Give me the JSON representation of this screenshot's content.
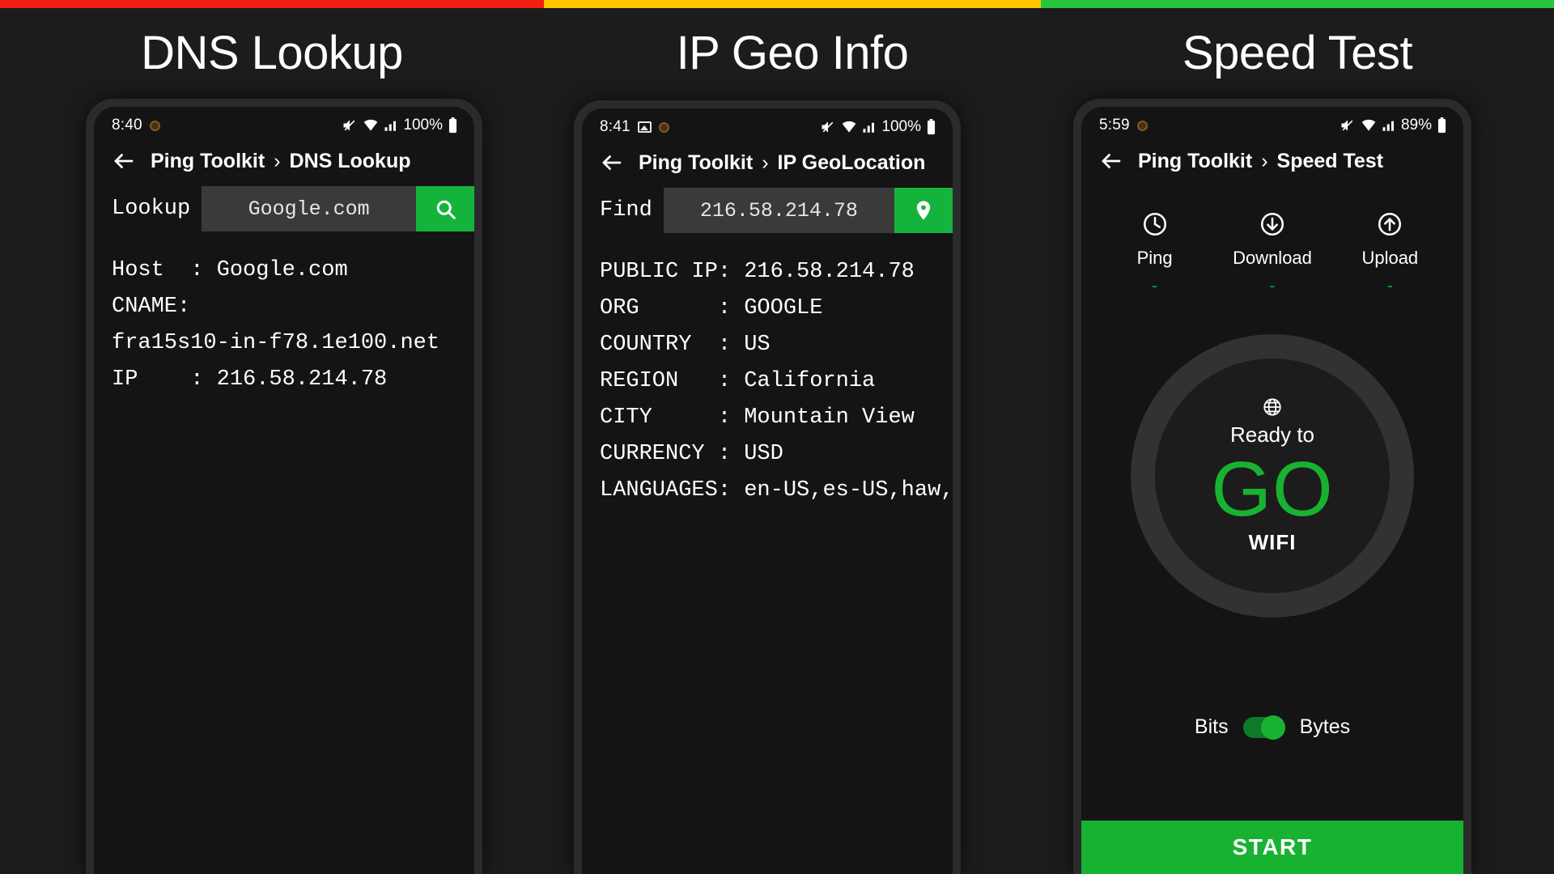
{
  "topbar": {
    "colors": [
      "#f01f12",
      "#ffc400",
      "#28c43c"
    ]
  },
  "accent": "#18b233",
  "panels": [
    {
      "title": "DNS Lookup",
      "status": {
        "time": "8:40",
        "battery": "100%"
      },
      "appbar": {
        "root": "Ping Toolkit",
        "separator": "›",
        "current": "DNS Lookup"
      },
      "input": {
        "label": "Lookup",
        "value": "Google.com",
        "placeholder": "Google.com",
        "button_icon": "search-icon"
      },
      "results": [
        "Host  : Google.com",
        "CNAME:",
        "fra15s10-in-f78.1e100.net",
        "IP    : 216.58.214.78"
      ]
    },
    {
      "title": "IP Geo Info",
      "status": {
        "time": "8:41",
        "battery": "100%"
      },
      "appbar": {
        "root": "Ping Toolkit",
        "separator": "›",
        "current": "IP GeoLocation"
      },
      "input": {
        "label": "Find",
        "value": "216.58.214.78",
        "placeholder": "216.58.214.78",
        "button_icon": "location-pin-icon"
      },
      "results": [
        "PUBLIC IP: 216.58.214.78",
        "ORG      : GOOGLE",
        "COUNTRY  : US",
        "REGION   : California",
        "CITY     : Mountain View",
        "CURRENCY : USD",
        "LANGUAGES: en-US,es-US,haw,fr"
      ]
    },
    {
      "title": "Speed Test",
      "status": {
        "time": "5:59",
        "battery": "89%"
      },
      "appbar": {
        "root": "Ping Toolkit",
        "separator": "›",
        "current": "Speed Test"
      },
      "metrics": [
        {
          "icon": "clock-icon",
          "label": "Ping",
          "value": "-"
        },
        {
          "icon": "download-arrow-icon",
          "label": "Download",
          "value": "-"
        },
        {
          "icon": "upload-arrow-icon",
          "label": "Upload",
          "value": "-"
        }
      ],
      "gauge": {
        "icon": "globe-icon",
        "ready_text": "Ready to",
        "go_text": "GO",
        "network": "WIFI"
      },
      "units": {
        "left": "Bits",
        "right": "Bytes",
        "selected": "Bytes"
      },
      "start_button": "START"
    }
  ]
}
